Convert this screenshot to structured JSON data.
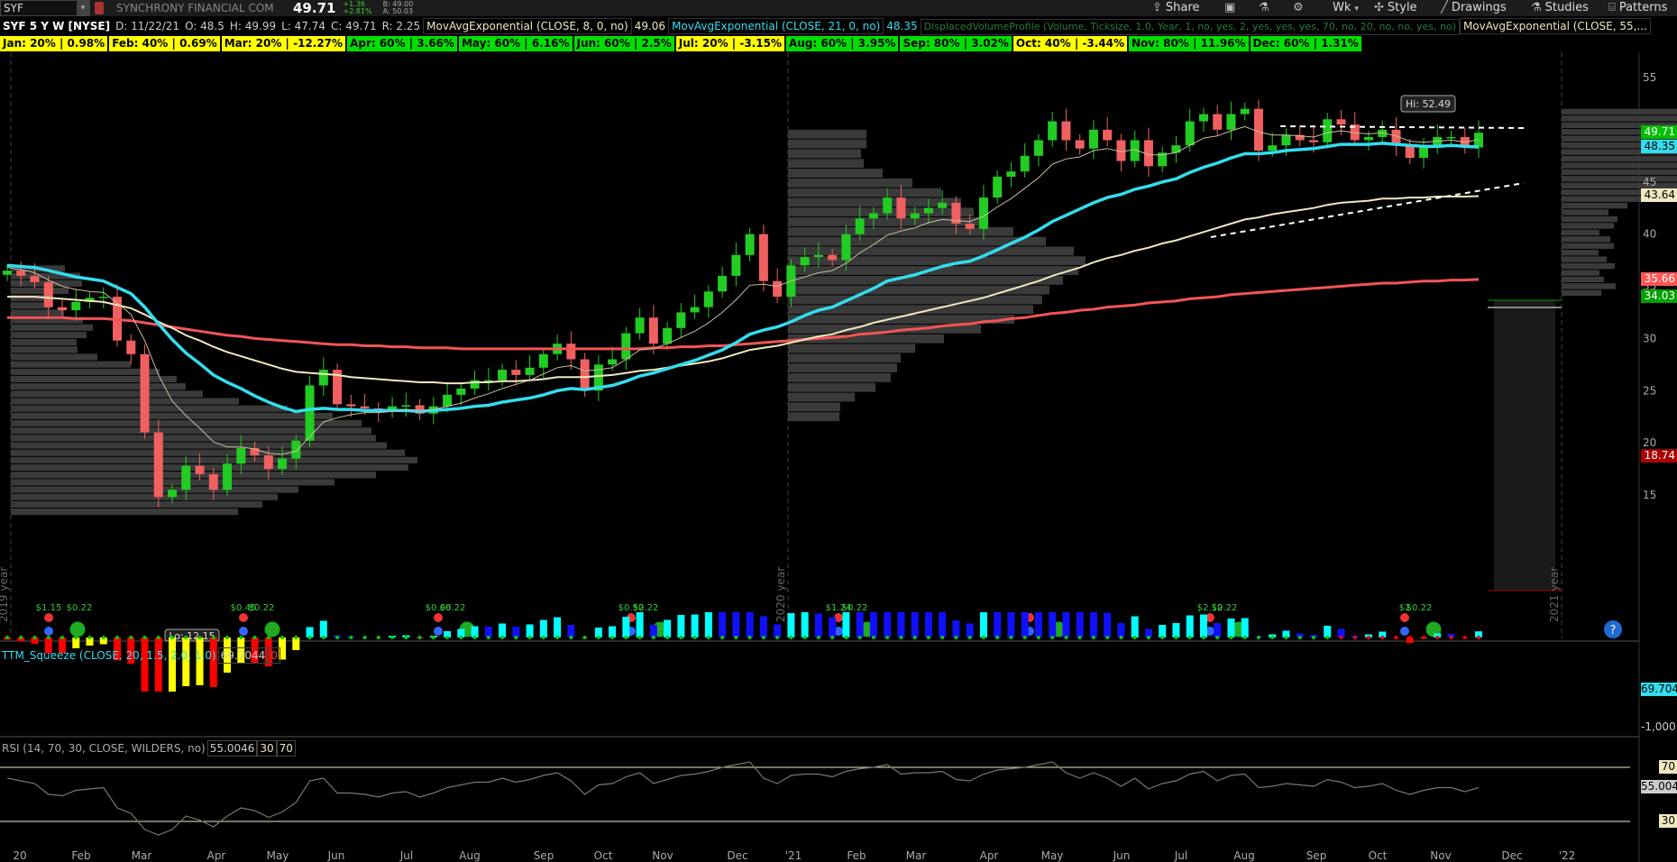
{
  "topbar": {
    "symbol": "SYF",
    "company": "SYNCHRONY FINANCIAL COM",
    "last": "49.71",
    "change": "+1.36",
    "change_pct": "+2.81%",
    "bid": "B: 49.00",
    "ask": "A: 50.03",
    "buttons": {
      "share": "Share",
      "timeframe": "Wk",
      "style": "Style",
      "drawings": "Drawings",
      "studies": "Studies",
      "patterns": "Patterns"
    }
  },
  "study_line": {
    "title": "SYF 5 Y W [NYSE]",
    "date": "D: 11/22/21",
    "open": "O: 48.5",
    "high": "H: 49.99",
    "low": "L: 47.74",
    "close": "C: 49.71",
    "range": "R: 2.25",
    "ema8_label": "MovAvgExponential (CLOSE, 8, 0, no)",
    "ema8_value": "49.06",
    "ema21_label": "MovAvgExponential (CLOSE, 21, 0, no)",
    "ema21_value": "48.35",
    "vp_label": "DisplacedVolumeProfile (Volume, Ticksize, 1.0, Year, 1, no, yes, 2, yes, yes, yes, 70, no, 20, no, no, yes, no)",
    "ema55_label": "MovAvgExponential (CLOSE, 55,..."
  },
  "seasonality": [
    {
      "text": "Jan: 20% | 0.98%",
      "color": "#ffff00"
    },
    {
      "text": "Feb: 40% | 0.69%",
      "color": "#ffff00"
    },
    {
      "text": "Mar: 20% | -12.27%",
      "color": "#ffff00"
    },
    {
      "text": "Apr: 60% | 3.66%",
      "color": "#00e000"
    },
    {
      "text": "May: 60% | 6.16%",
      "color": "#00e000"
    },
    {
      "text": "Jun: 60% | 2.5%",
      "color": "#00e000"
    },
    {
      "text": "Jul: 20% | -3.15%",
      "color": "#ffff00"
    },
    {
      "text": "Aug: 60% | 3.95%",
      "color": "#00e000"
    },
    {
      "text": "Sep: 80% | 3.02%",
      "color": "#00e000"
    },
    {
      "text": "Oct: 40% | -3.44%",
      "color": "#ffff00"
    },
    {
      "text": "Nov: 80% | 11.96%",
      "color": "#00e000"
    },
    {
      "text": "Dec: 60% | 1.31%",
      "color": "#00e000"
    }
  ],
  "chart_data": {
    "type": "candlestick",
    "price_axis": {
      "ylim": [
        12,
        56
      ],
      "ticks": [
        55,
        50,
        45,
        40,
        35,
        30,
        25,
        20,
        15
      ]
    },
    "price_tags": [
      {
        "value": "49.71",
        "y": 49.71,
        "color": "#00c000",
        "text_color": "#fff"
      },
      {
        "value": "48.35",
        "y": 48.35,
        "color": "#33ddee",
        "text_color": "#000"
      },
      {
        "value": "43.64",
        "y": 43.64,
        "color": "#f0e8c0",
        "text_color": "#000"
      },
      {
        "value": "35.66",
        "y": 35.66,
        "color": "#ff5555",
        "text_color": "#fff"
      },
      {
        "value": "34.03",
        "y": 34.03,
        "color": "#00a000",
        "text_color": "#fff"
      },
      {
        "value": "18.74",
        "y": 18.74,
        "color": "#aa0000",
        "text_color": "#fff"
      }
    ],
    "hi_label": "Hi: 52.49",
    "lo_label": "Lo: 12.15",
    "year_labels": [
      "2019 year",
      "2020 year",
      "2021 year"
    ],
    "x_labels": [
      "20",
      "Feb",
      "Mar",
      "Apr",
      "May",
      "Jun",
      "Jul",
      "Aug",
      "Sep",
      "Oct",
      "Nov",
      "Dec",
      "'21",
      "Feb",
      "Mar",
      "Apr",
      "May",
      "Jun",
      "Jul",
      "Aug",
      "Sep",
      "Oct",
      "Nov",
      "Dec",
      "'22"
    ],
    "dividends": [
      "$1.15",
      "$0.22",
      "$0.45",
      "$0.22",
      "$0.06",
      "$0.22",
      "$0.52",
      "$0.22",
      "$1.24",
      "$0.22",
      "$2.12",
      "$0.22",
      "$2",
      "$0.22"
    ],
    "closes": [
      36.5,
      36.0,
      35.4,
      33.0,
      32.7,
      33.5,
      33.9,
      34.0,
      29.8,
      28.5,
      21.0,
      14.8,
      15.5,
      17.8,
      17.0,
      15.5,
      18.0,
      19.5,
      18.8,
      17.5,
      18.5,
      20.2,
      25.5,
      27.0,
      23.7,
      23.5,
      23.3,
      23.0,
      23.5,
      23.6,
      22.8,
      23.5,
      24.6,
      25.2,
      26.0,
      26.0,
      27.0,
      26.5,
      27.2,
      28.5,
      29.5,
      28.0,
      25.0,
      27.5,
      28.0,
      30.5,
      32.0,
      29.5,
      31.0,
      32.5,
      33.0,
      34.5,
      36.0,
      38.0,
      40.0,
      35.5,
      34.0,
      37.0,
      37.8,
      38.0,
      37.5,
      40.0,
      41.5,
      42.0,
      43.5,
      41.5,
      42.0,
      42.5,
      43.0,
      41.0,
      40.5,
      43.5,
      45.5,
      46.0,
      47.5,
      49.0,
      50.8,
      49.0,
      48.2,
      50.0,
      49.0,
      47.0,
      49.0,
      46.5,
      47.8,
      48.5,
      50.8,
      51.5,
      50.0,
      51.5,
      52.0,
      48.0,
      48.5,
      49.5,
      49.0,
      48.8,
      51.0,
      50.5,
      49.0,
      49.3,
      50.0,
      48.5,
      47.3,
      48.3,
      49.3,
      49.3,
      48.3,
      49.71
    ],
    "ema8": [
      36.8,
      36.6,
      36.3,
      35.6,
      35.0,
      34.7,
      34.5,
      34.4,
      33.4,
      32.3,
      29.8,
      26.5,
      24.0,
      22.6,
      21.4,
      20.1,
      19.6,
      19.6,
      19.4,
      19.0,
      18.9,
      19.2,
      20.6,
      22.0,
      22.4,
      22.7,
      22.9,
      22.9,
      23.0,
      23.2,
      23.1,
      23.2,
      23.5,
      23.8,
      24.3,
      24.7,
      25.2,
      25.6,
      26.0,
      26.6,
      27.2,
      27.4,
      26.9,
      27.0,
      27.2,
      28.0,
      28.9,
      29.0,
      29.5,
      30.1,
      30.7,
      31.5,
      32.5,
      33.7,
      35.1,
      35.2,
      35.0,
      35.5,
      35.9,
      36.3,
      36.5,
      37.2,
      38.2,
      39.0,
      39.9,
      40.3,
      40.6,
      41.1,
      41.4,
      41.3,
      41.2,
      41.7,
      42.6,
      43.4,
      44.4,
      45.4,
      46.7,
      47.2,
      47.4,
      48.0,
      48.2,
      47.9,
      48.1,
      47.6,
      47.6,
      47.8,
      48.5,
      49.2,
      49.4,
      49.9,
      50.3,
      49.8,
      49.5,
      49.5,
      49.4,
      49.3,
      49.7,
      49.9,
      49.7,
      49.6,
      49.7,
      49.4,
      48.9,
      48.8,
      48.9,
      49.0,
      48.8,
      49.06
    ],
    "ema21": [
      37.0,
      36.9,
      36.8,
      36.5,
      36.2,
      35.9,
      35.7,
      35.5,
      34.9,
      34.3,
      33.0,
      31.4,
      29.9,
      28.6,
      27.6,
      26.5,
      25.8,
      25.2,
      24.5,
      23.9,
      23.4,
      23.0,
      23.2,
      23.3,
      23.2,
      23.2,
      23.1,
      23.1,
      23.1,
      23.1,
      23.0,
      23.1,
      23.2,
      23.3,
      23.5,
      23.6,
      23.9,
      24.1,
      24.3,
      24.6,
      25.0,
      25.2,
      25.1,
      25.3,
      25.5,
      25.9,
      26.4,
      26.7,
      27.1,
      27.5,
      27.9,
      28.4,
      28.9,
      29.6,
      30.4,
      30.8,
      31.1,
      31.6,
      32.2,
      32.7,
      33.0,
      33.6,
      34.2,
      34.8,
      35.5,
      35.8,
      36.1,
      36.5,
      36.9,
      37.2,
      37.4,
      37.9,
      38.5,
      39.1,
      39.7,
      40.4,
      41.2,
      41.8,
      42.4,
      43.0,
      43.5,
      43.8,
      44.3,
      44.6,
      45.0,
      45.3,
      45.9,
      46.4,
      46.8,
      47.3,
      47.7,
      47.7,
      47.8,
      48.0,
      48.1,
      48.2,
      48.4,
      48.6,
      48.6,
      48.6,
      48.7,
      48.6,
      48.5,
      48.4,
      48.4,
      48.5,
      48.4,
      48.35
    ],
    "ema55": [
      34.0,
      34.0,
      34.0,
      33.9,
      33.8,
      33.7,
      33.6,
      33.5,
      33.2,
      32.9,
      32.3,
      31.6,
      31.0,
      30.3,
      29.8,
      29.2,
      28.7,
      28.3,
      27.9,
      27.5,
      27.1,
      26.8,
      26.7,
      26.6,
      26.5,
      26.3,
      26.2,
      26.1,
      26.0,
      25.9,
      25.8,
      25.8,
      25.7,
      25.7,
      25.8,
      25.8,
      25.9,
      25.9,
      26.0,
      26.1,
      26.3,
      26.3,
      26.3,
      26.4,
      26.5,
      26.7,
      26.9,
      27.0,
      27.2,
      27.4,
      27.6,
      27.8,
      28.1,
      28.5,
      28.9,
      29.1,
      29.3,
      29.6,
      29.9,
      30.2,
      30.4,
      30.8,
      31.1,
      31.5,
      31.8,
      32.1,
      32.4,
      32.7,
      33.0,
      33.3,
      33.6,
      33.9,
      34.3,
      34.7,
      35.1,
      35.5,
      36.0,
      36.4,
      36.8,
      37.3,
      37.7,
      38.0,
      38.4,
      38.7,
      39.1,
      39.4,
      39.8,
      40.2,
      40.6,
      41.0,
      41.4,
      41.6,
      41.9,
      42.1,
      42.3,
      42.5,
      42.8,
      43.0,
      43.1,
      43.2,
      43.4,
      43.4,
      43.5,
      43.5,
      43.6,
      43.6,
      43.6,
      43.64
    ],
    "ema200": [
      32.0,
      32.0,
      32.0,
      32.0,
      32.0,
      31.9,
      31.9,
      31.9,
      31.8,
      31.7,
      31.5,
      31.3,
      31.1,
      30.9,
      30.7,
      30.5,
      30.3,
      30.2,
      30.0,
      29.9,
      29.8,
      29.7,
      29.6,
      29.5,
      29.4,
      29.4,
      29.3,
      29.3,
      29.2,
      29.2,
      29.1,
      29.1,
      29.1,
      29.0,
      29.0,
      29.0,
      29.0,
      29.0,
      29.0,
      29.0,
      29.0,
      29.0,
      29.0,
      29.0,
      29.0,
      29.0,
      29.0,
      29.1,
      29.1,
      29.2,
      29.2,
      29.3,
      29.3,
      29.4,
      29.5,
      29.6,
      29.7,
      29.8,
      29.9,
      30.0,
      30.1,
      30.2,
      30.4,
      30.5,
      30.6,
      30.8,
      30.9,
      31.0,
      31.2,
      31.3,
      31.4,
      31.6,
      31.7,
      31.9,
      32.0,
      32.2,
      32.4,
      32.5,
      32.7,
      32.8,
      33.0,
      33.1,
      33.2,
      33.4,
      33.5,
      33.6,
      33.8,
      33.9,
      34.0,
      34.2,
      34.3,
      34.4,
      34.5,
      34.6,
      34.7,
      34.8,
      34.9,
      35.0,
      35.1,
      35.2,
      35.3,
      35.3,
      35.4,
      35.5,
      35.5,
      35.6,
      35.6,
      35.66
    ]
  },
  "squeeze": {
    "label": "TTM_Squeeze (CLOSE, 20, 1.5, 2.0, 1.0)",
    "value": "69.7044",
    "flag": "0",
    "axis_value": "69.704",
    "axis_low": "-1,000"
  },
  "rsi": {
    "label": "RSI (14, 70, 30, CLOSE, WILDERS, no)",
    "value": "55.0046",
    "lower": "30",
    "upper": "70",
    "axis_value": "55.004",
    "axis_70": "70",
    "axis_30": "30",
    "series": [
      62,
      60,
      58,
      50,
      49,
      53,
      54,
      55,
      40,
      36,
      24,
      20,
      24,
      34,
      31,
      26,
      34,
      40,
      38,
      33,
      37,
      44,
      60,
      62,
      51,
      51,
      50,
      48,
      51,
      52,
      48,
      51,
      55,
      57,
      59,
      59,
      62,
      59,
      61,
      64,
      66,
      60,
      50,
      57,
      58,
      63,
      66,
      58,
      61,
      64,
      65,
      67,
      70,
      72,
      74,
      62,
      58,
      64,
      65,
      65,
      63,
      67,
      69,
      70,
      72,
      65,
      66,
      66,
      67,
      61,
      60,
      65,
      68,
      69,
      70,
      72,
      74,
      66,
      62,
      66,
      62,
      56,
      62,
      54,
      58,
      60,
      65,
      67,
      60,
      64,
      65,
      55,
      56,
      58,
      57,
      56,
      61,
      59,
      55,
      56,
      58,
      53,
      50,
      53,
      55,
      55,
      52,
      55
    ]
  }
}
